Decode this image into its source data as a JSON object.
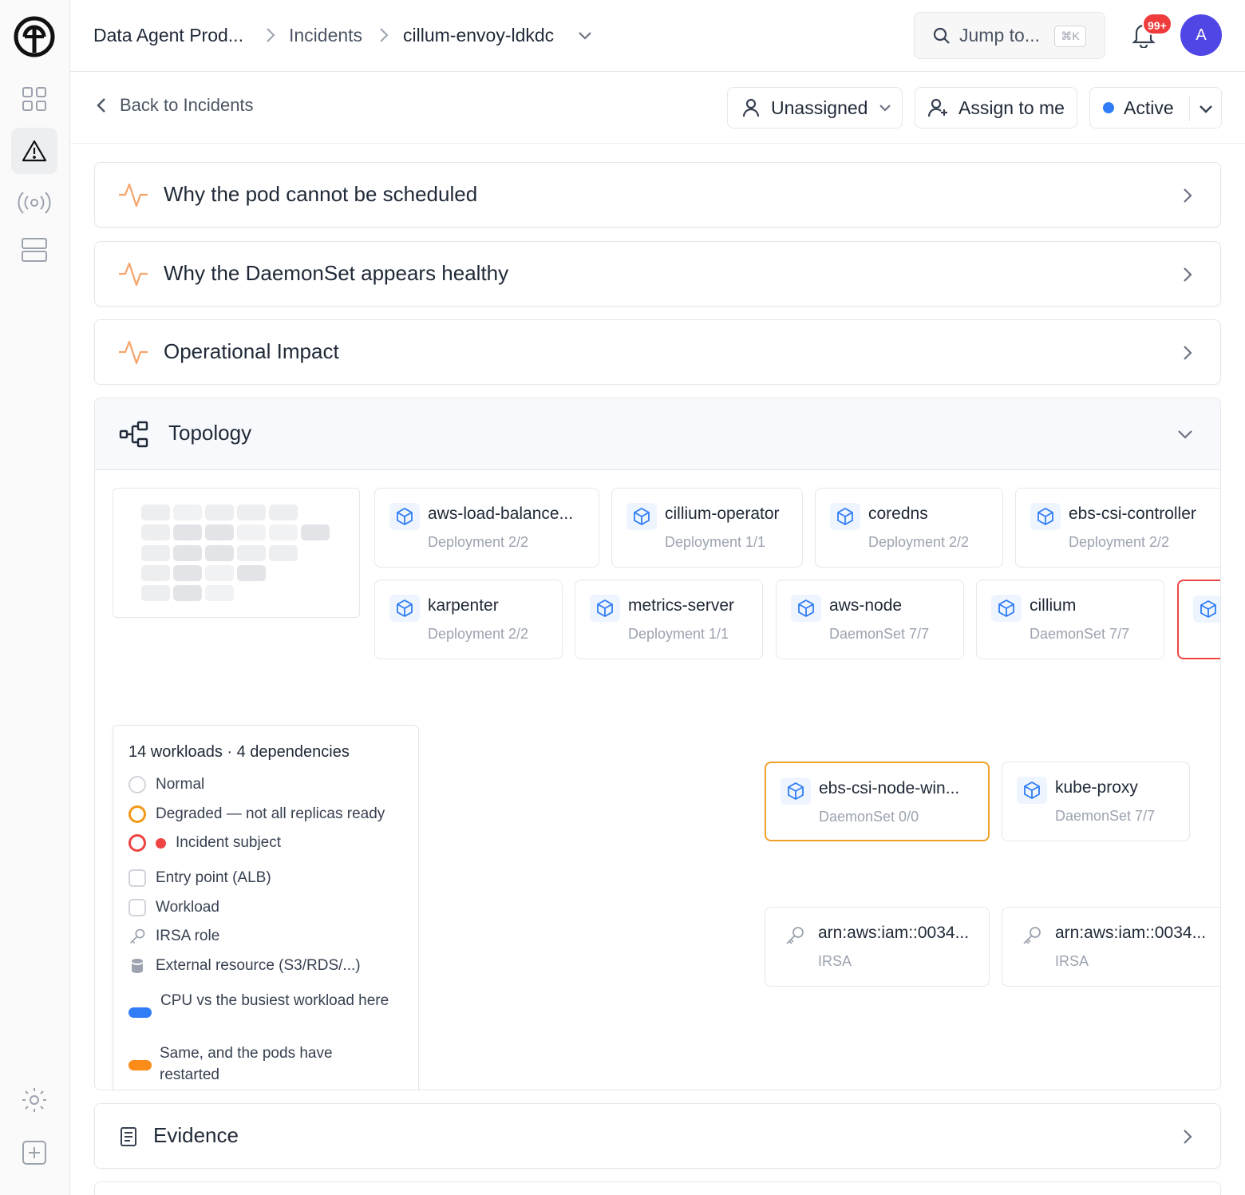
{
  "breadcrumb": {
    "project": "Data Agent Prod...",
    "section": "Incidents",
    "current": "cillum-envoy-ldkdc"
  },
  "search": {
    "placeholder": "Jump to...",
    "shortcut": "⌘K"
  },
  "notifications": {
    "count": "99+"
  },
  "user": {
    "initial": "A"
  },
  "subheader": {
    "back_label": "Back to Incidents",
    "assignee_label": "Unassigned",
    "assign_me_label": "Assign to me",
    "status_label": "Active",
    "status_color": "#2f7cf6"
  },
  "sections": [
    {
      "title": "Why the pod cannot be scheduled",
      "icon": "activity-icon"
    },
    {
      "title": "Why the DaemonSet appears healthy",
      "icon": "activity-icon"
    },
    {
      "title": "Operational Impact",
      "icon": "activity-icon"
    }
  ],
  "topology": {
    "title": "Topology",
    "nodes": [
      {
        "name": "aws-load-balance...",
        "sub": "Deployment 2/2",
        "icon": "cube-icon",
        "state": "normal"
      },
      {
        "name": "cillium-operator",
        "sub": "Deployment 1/1",
        "icon": "cube-icon",
        "state": "normal"
      },
      {
        "name": "coredns",
        "sub": "Deployment 2/2",
        "icon": "cube-icon",
        "state": "normal"
      },
      {
        "name": "ebs-csi-controller",
        "sub": "Deployment 2/2",
        "icon": "cube-icon",
        "state": "normal"
      },
      {
        "name": "karpenter",
        "sub": "Deployment 2/2",
        "icon": "cube-icon",
        "state": "normal"
      },
      {
        "name": "metrics-server",
        "sub": "Deployment 1/1",
        "icon": "cube-icon",
        "state": "normal"
      },
      {
        "name": "aws-node",
        "sub": "DaemonSet 7/7",
        "icon": "cube-icon",
        "state": "normal"
      },
      {
        "name": "cillium",
        "sub": "DaemonSet 7/7",
        "icon": "cube-icon",
        "state": "normal"
      },
      {
        "name": "",
        "sub": "",
        "icon": "cube-icon",
        "state": "incident"
      },
      {
        "name": "ebs-csi-node-win...",
        "sub": "DaemonSet 0/0",
        "icon": "cube-icon",
        "state": "degraded"
      },
      {
        "name": "kube-proxy",
        "sub": "DaemonSet 7/7",
        "icon": "cube-icon",
        "state": "normal"
      },
      {
        "name": "arn:aws:iam::0034...",
        "sub": "IRSA",
        "icon": "key-icon",
        "state": "normal"
      },
      {
        "name": "arn:aws:iam::0034...",
        "sub": "IRSA",
        "icon": "key-icon",
        "state": "normal"
      }
    ],
    "legend": {
      "summary": "14 workloads · 4 dependencies",
      "normal": "Normal",
      "degraded": "Degraded — not all replicas ready",
      "incident": "Incident subject",
      "entry": "Entry point (ALB)",
      "workload": "Workload",
      "irsa": "IRSA role",
      "external": "External resource (S3/RDS/...)",
      "cpu_blue": "CPU vs the busiest workload here",
      "cpu_orange": "Same, and the pods have restarted",
      "colors": {
        "degraded": "#f29a1a",
        "incident": "#ef4444",
        "cpu": "#2f7cf6",
        "restarted": "#fb8c1a"
      }
    }
  },
  "evidence": {
    "title": "Evidence",
    "icon": "document-icon"
  }
}
